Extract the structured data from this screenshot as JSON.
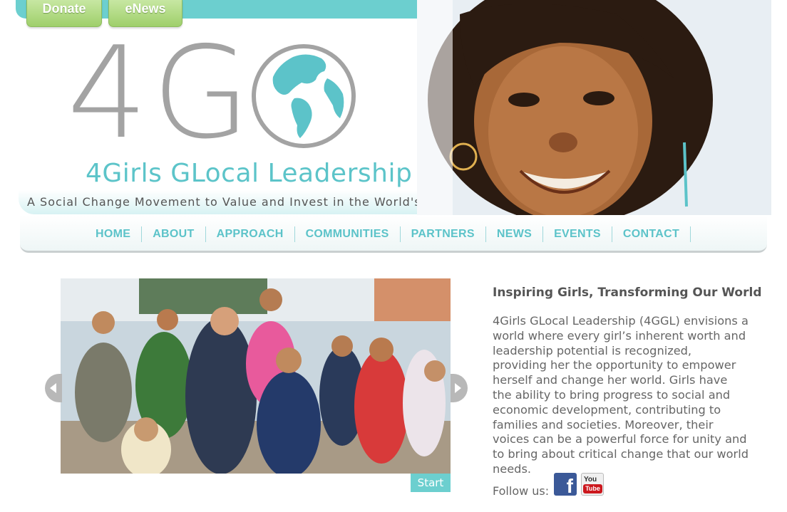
{
  "top_buttons": {
    "donate_label": "Donate",
    "enews_label": "eNews"
  },
  "logo": {
    "mark": "4GGL",
    "name": "4Girls GLocal Leadership",
    "tagline": "A Social Change Movement to Value and Invest in the World's Poorest Girls",
    "globe_icon": "globe-icon"
  },
  "nav": {
    "items": [
      "HOME",
      "ABOUT",
      "APPROACH",
      "COMMUNITIES",
      "PARTNERS",
      "NEWS",
      "EVENTS",
      "CONTACT"
    ]
  },
  "slideshow": {
    "start_label": "Start",
    "prev_icon": "chevron-left-icon",
    "next_icon": "chevron-right-icon"
  },
  "intro": {
    "title": "Inspiring Girls, Transforming Our World",
    "body": "4Girls GLocal Leadership (4GGL) envisions a world where every girl’s inherent worth and leadership potential is recognized, providing her the opportunity to empower herself and change her world. Girls have the ability to bring progress to social and economic development, contributing to families and societies. Moreover, their voices can be a powerful force for unity and to bring about critical change that our world needs."
  },
  "social": {
    "follow_label": "Follow us:",
    "facebook_glyph": "f",
    "youtube_you": "You",
    "youtube_tube": "Tube"
  },
  "colors": {
    "accent_teal": "#6ccfcf",
    "nav_text": "#5cc3c9",
    "donate_green": "#9fcf6b",
    "facebook_blue": "#3b5998",
    "youtube_red": "#cc181e"
  }
}
